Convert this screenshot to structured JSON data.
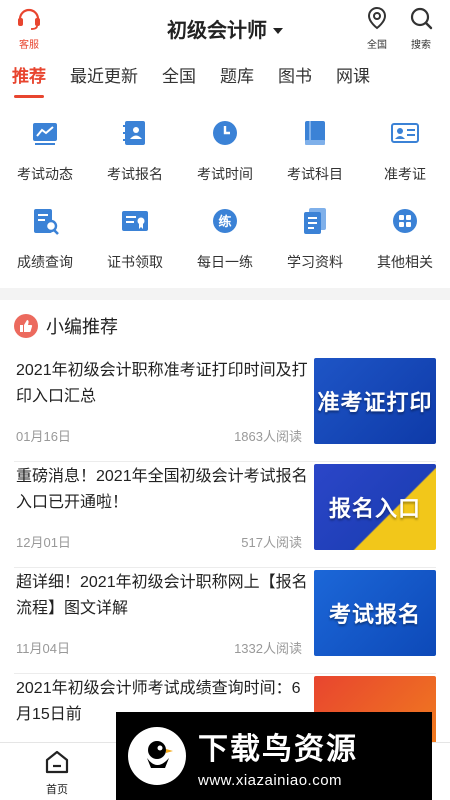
{
  "header": {
    "kefu_label": "客服",
    "title": "初级会计师",
    "region_label": "全国",
    "search_label": "搜索"
  },
  "tabs": [
    {
      "label": "推荐",
      "active": true
    },
    {
      "label": "最近更新",
      "active": false
    },
    {
      "label": "全国",
      "active": false
    },
    {
      "label": "题库",
      "active": false
    },
    {
      "label": "图书",
      "active": false
    },
    {
      "label": "网课",
      "active": false
    }
  ],
  "grid": [
    {
      "label": "考试动态",
      "icon": "trend-chart-icon"
    },
    {
      "label": "考试报名",
      "icon": "contact-book-icon"
    },
    {
      "label": "考试时间",
      "icon": "clock-icon"
    },
    {
      "label": "考试科目",
      "icon": "book-icon"
    },
    {
      "label": "准考证",
      "icon": "id-card-icon"
    },
    {
      "label": "成绩查询",
      "icon": "document-search-icon"
    },
    {
      "label": "证书领取",
      "icon": "certificate-icon"
    },
    {
      "label": "每日一练",
      "icon": "practice-icon"
    },
    {
      "label": "学习资料",
      "icon": "files-icon"
    },
    {
      "label": "其他相关",
      "icon": "apps-grid-icon"
    }
  ],
  "section": {
    "title": "小编推荐",
    "icon": "thumbs-up-icon"
  },
  "articles": [
    {
      "title": "2021年初级会计职称准考证打印时间及打印入口汇总",
      "date": "01月16日",
      "reads": "1863人阅读",
      "thumb_text": "准考证打印"
    },
    {
      "title": "重磅消息！2021年全国初级会计考试报名入口已开通啦！",
      "date": "12月01日",
      "reads": "517人阅读",
      "thumb_text": "报名入口"
    },
    {
      "title": "超详细！2021年初级会计职称网上【报名流程】图文详解",
      "date": "11月04日",
      "reads": "1332人阅读",
      "thumb_text": "考试报名"
    },
    {
      "title": "2021年初级会计师考试成绩查询时间：6月15日前",
      "date": "",
      "reads": "",
      "thumb_text": ""
    }
  ],
  "bottom_nav": {
    "home_label": "首页"
  },
  "watermark": {
    "main": "下载鸟资源",
    "sub": "www.xiazainiao.com"
  },
  "colors": {
    "accent": "#e8452f",
    "divider": "#f3f3f3",
    "icon_blue": "#3b82d6"
  }
}
